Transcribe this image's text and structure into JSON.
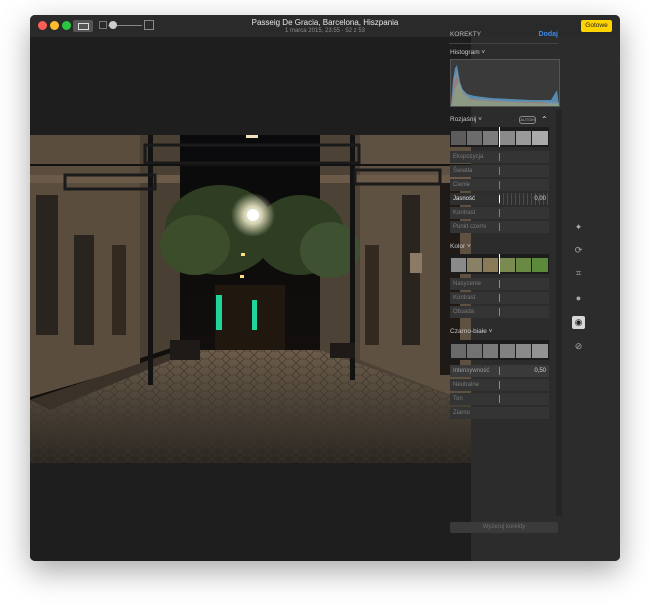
{
  "window": {
    "title": "Passeig De Gracia, Barcelona, Hiszpania",
    "subtitle": "1 marca 2015, 23:55  ·  52 z 53",
    "done_label": "Gotowe"
  },
  "panel": {
    "header": "KOREKTY",
    "add_label": "Dodaj",
    "histogram_label": "Histogram ˅",
    "sections": {
      "light": {
        "title": "Rozjaśnij ˅",
        "auto_label": "AUTOM",
        "sliders": [
          {
            "label": "Ekspozycja",
            "value": ""
          },
          {
            "label": "Światła",
            "value": ""
          },
          {
            "label": "Cienie",
            "value": ""
          },
          {
            "label": "Jasność",
            "value": "0,00"
          },
          {
            "label": "Kontrast",
            "value": ""
          },
          {
            "label": "Punkt czerni",
            "value": ""
          }
        ]
      },
      "color": {
        "title": "Kolor ˅",
        "sliders": [
          {
            "label": "Nasycenie",
            "value": ""
          },
          {
            "label": "Kontrast",
            "value": ""
          },
          {
            "label": "Obsada",
            "value": ""
          }
        ]
      },
      "bw": {
        "title": "Czarno-białe ˅",
        "sliders": [
          {
            "label": "Intensywność",
            "value": "0,50"
          },
          {
            "label": "Neutralne",
            "value": ""
          },
          {
            "label": "Ton",
            "value": ""
          },
          {
            "label": "Ziarno",
            "value": ""
          }
        ]
      }
    },
    "reset_label": "Wyzeruj korekty"
  },
  "tools": [
    "magic-wand-icon",
    "rotate-icon",
    "crop-icon",
    "filters-icon",
    "adjust-icon",
    "retouch-icon"
  ],
  "colors": {
    "accent": "#3b8bea",
    "done": "#ffd400",
    "panel": "#2c2c2c"
  }
}
